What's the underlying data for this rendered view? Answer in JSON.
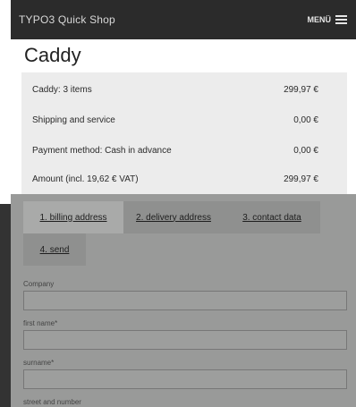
{
  "header": {
    "brand": "TYPO3 Quick Shop",
    "menu_label": "MENÜ"
  },
  "page_title": "Caddy",
  "summary": [
    {
      "label": "Caddy: 3 items",
      "value": "299,97 €"
    },
    {
      "label": "Shipping and service",
      "value": "0,00 €"
    },
    {
      "label": "Payment method: Cash in advance",
      "value": "0,00 €"
    },
    {
      "label": "Amount (incl. 19,62 € VAT)",
      "value": "299,97 €"
    }
  ],
  "tabs": [
    {
      "label": "1. billing address"
    },
    {
      "label": "2. delivery address"
    },
    {
      "label": "3. contact data"
    },
    {
      "label": "4. send"
    }
  ],
  "form": {
    "company_label": "Company",
    "first_name_label": "first name*",
    "surname_label": "surname*",
    "street_label": "street and number"
  }
}
